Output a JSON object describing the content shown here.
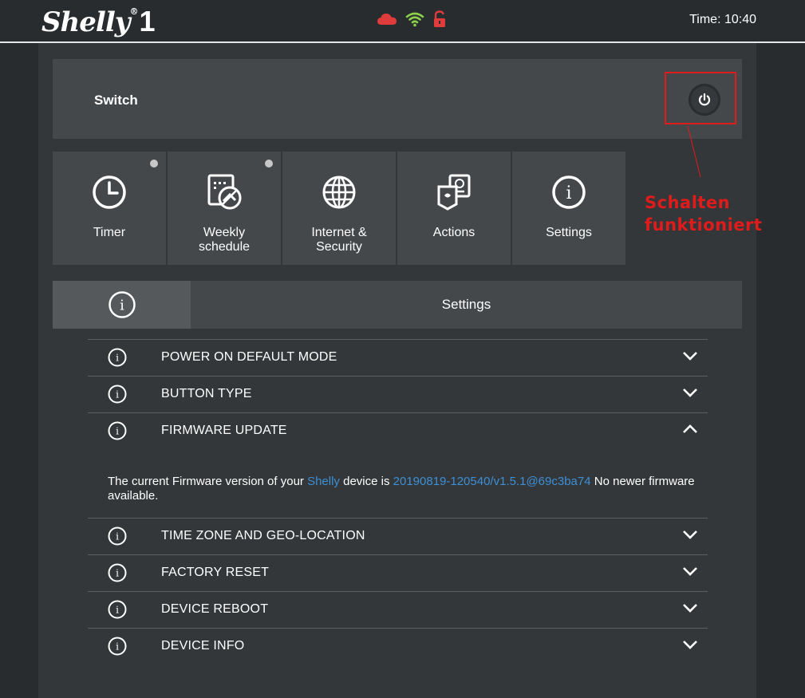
{
  "header": {
    "logo_text": "Shelly",
    "logo_mark": "®",
    "logo_number": "1",
    "status_icons": [
      "cloud-icon",
      "wifi-icon",
      "unlock-icon"
    ],
    "cloud_color": "#e03c3c",
    "wifi_color": "#8ed04a",
    "lock_color": "#e03c3c",
    "time_label": "Time: 10:40"
  },
  "switch": {
    "label": "Switch",
    "power_icon": "power-icon"
  },
  "annotation": {
    "line1": "Schalten",
    "line2": "funktioniert",
    "color": "#e01b1b"
  },
  "tiles": [
    {
      "icon": "clock-icon",
      "line1": "Timer",
      "line2": "",
      "dot": true
    },
    {
      "icon": "schedule-icon",
      "line1": "Weekly",
      "line2": "schedule",
      "dot": true
    },
    {
      "icon": "globe-icon",
      "line1": "Internet &",
      "line2": "Security",
      "dot": false
    },
    {
      "icon": "actions-icon",
      "line1": "Actions",
      "line2": "",
      "dot": false
    },
    {
      "icon": "info-icon",
      "line1": "Settings",
      "line2": "",
      "dot": false
    }
  ],
  "settings": {
    "title": "Settings",
    "items": [
      {
        "label": "POWER ON DEFAULT MODE",
        "expanded": false
      },
      {
        "label": "BUTTON TYPE",
        "expanded": false
      },
      {
        "label": "FIRMWARE UPDATE",
        "expanded": true
      },
      {
        "label": "TIME ZONE AND GEO-LOCATION",
        "expanded": false
      },
      {
        "label": "FACTORY RESET",
        "expanded": false
      },
      {
        "label": "DEVICE REBOOT",
        "expanded": false
      },
      {
        "label": "DEVICE INFO",
        "expanded": false
      }
    ],
    "firmware": {
      "text1": "The current Firmware version of your ",
      "link1": "Shelly",
      "text2": " device is ",
      "version": "20190819-120540/v1.5.1@69c3ba74",
      "text3": " No newer firmware available."
    },
    "link_color": "#3d8fd6"
  }
}
